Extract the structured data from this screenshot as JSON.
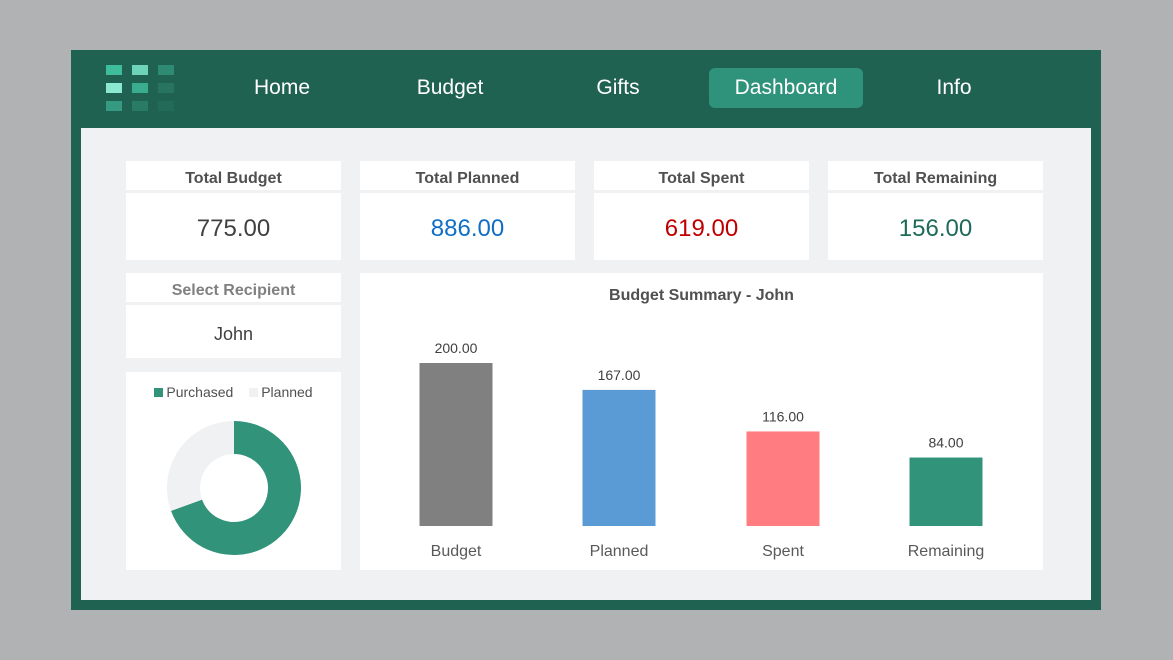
{
  "nav": {
    "items": [
      {
        "label": "Home",
        "active": false
      },
      {
        "label": "Budget",
        "active": false
      },
      {
        "label": "Gifts",
        "active": false
      },
      {
        "label": "Dashboard",
        "active": true
      },
      {
        "label": "Info",
        "active": false
      }
    ]
  },
  "logo": {
    "icon": "grid-logo-icon"
  },
  "kpis": [
    {
      "title": "Total Budget",
      "value": "775.00",
      "color": "#404040"
    },
    {
      "title": "Total Planned",
      "value": "886.00",
      "color": "#0f6fc6"
    },
    {
      "title": "Total Spent",
      "value": "619.00",
      "color": "#c00000"
    },
    {
      "title": "Total Remaining",
      "value": "156.00",
      "color": "#1e6b5a"
    }
  ],
  "recipient": {
    "title": "Select Recipient",
    "value": "John"
  },
  "colors": {
    "brand": "#206252",
    "accent": "#2f927a",
    "budget": "#808080",
    "planned": "#5b9bd5",
    "spent": "#ff7c80",
    "remaining": "#31937a",
    "donut_planned": "#f0f1f3"
  },
  "chart_data": [
    {
      "type": "pie",
      "variant": "donut",
      "title": "",
      "legend": [
        "Purchased",
        "Planned"
      ],
      "legend_position": "top",
      "labels": [
        "Purchased",
        "Planned"
      ],
      "values": [
        116,
        51
      ]
    },
    {
      "type": "bar",
      "title": "Budget Summary - John",
      "categories": [
        "Budget",
        "Planned",
        "Spent",
        "Remaining"
      ],
      "values": [
        200,
        167,
        116,
        84
      ],
      "data_labels": [
        "200.00",
        "167.00",
        "116.00",
        "84.00"
      ],
      "xlabel": "",
      "ylabel": "",
      "ylim": [
        0,
        200
      ],
      "grid": false
    }
  ]
}
